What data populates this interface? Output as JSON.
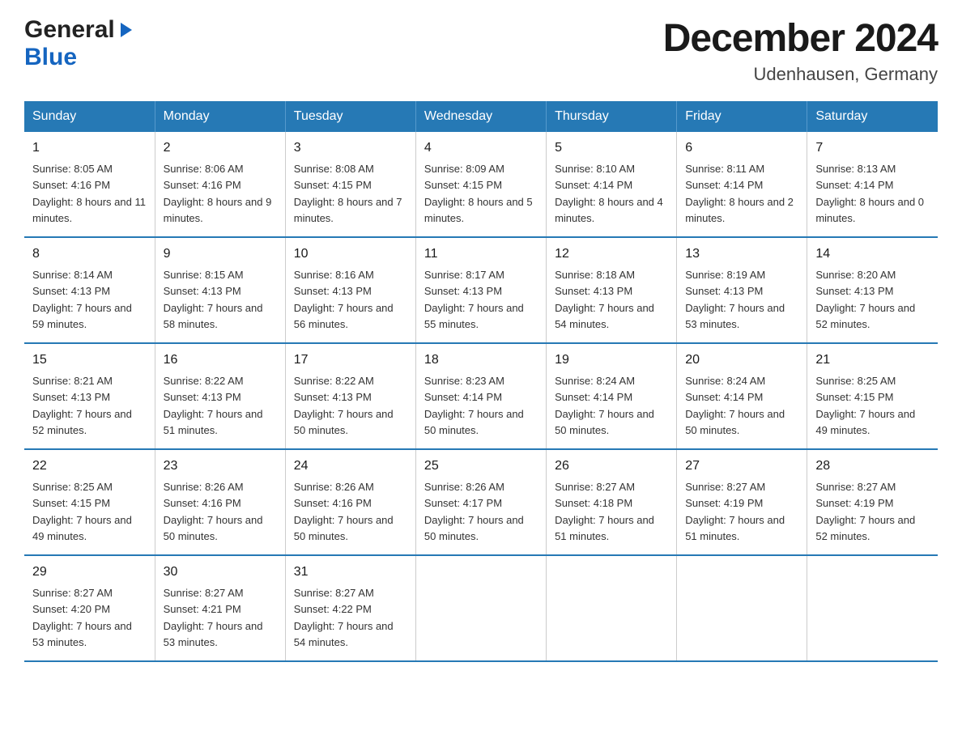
{
  "header": {
    "logo_general": "General",
    "logo_blue": "Blue",
    "month_title": "December 2024",
    "location": "Udenhausen, Germany"
  },
  "weekdays": [
    "Sunday",
    "Monday",
    "Tuesday",
    "Wednesday",
    "Thursday",
    "Friday",
    "Saturday"
  ],
  "weeks": [
    [
      {
        "day": "1",
        "sunrise": "8:05 AM",
        "sunset": "4:16 PM",
        "daylight": "8 hours and 11 minutes."
      },
      {
        "day": "2",
        "sunrise": "8:06 AM",
        "sunset": "4:16 PM",
        "daylight": "8 hours and 9 minutes."
      },
      {
        "day": "3",
        "sunrise": "8:08 AM",
        "sunset": "4:15 PM",
        "daylight": "8 hours and 7 minutes."
      },
      {
        "day": "4",
        "sunrise": "8:09 AM",
        "sunset": "4:15 PM",
        "daylight": "8 hours and 5 minutes."
      },
      {
        "day": "5",
        "sunrise": "8:10 AM",
        "sunset": "4:14 PM",
        "daylight": "8 hours and 4 minutes."
      },
      {
        "day": "6",
        "sunrise": "8:11 AM",
        "sunset": "4:14 PM",
        "daylight": "8 hours and 2 minutes."
      },
      {
        "day": "7",
        "sunrise": "8:13 AM",
        "sunset": "4:14 PM",
        "daylight": "8 hours and 0 minutes."
      }
    ],
    [
      {
        "day": "8",
        "sunrise": "8:14 AM",
        "sunset": "4:13 PM",
        "daylight": "7 hours and 59 minutes."
      },
      {
        "day": "9",
        "sunrise": "8:15 AM",
        "sunset": "4:13 PM",
        "daylight": "7 hours and 58 minutes."
      },
      {
        "day": "10",
        "sunrise": "8:16 AM",
        "sunset": "4:13 PM",
        "daylight": "7 hours and 56 minutes."
      },
      {
        "day": "11",
        "sunrise": "8:17 AM",
        "sunset": "4:13 PM",
        "daylight": "7 hours and 55 minutes."
      },
      {
        "day": "12",
        "sunrise": "8:18 AM",
        "sunset": "4:13 PM",
        "daylight": "7 hours and 54 minutes."
      },
      {
        "day": "13",
        "sunrise": "8:19 AM",
        "sunset": "4:13 PM",
        "daylight": "7 hours and 53 minutes."
      },
      {
        "day": "14",
        "sunrise": "8:20 AM",
        "sunset": "4:13 PM",
        "daylight": "7 hours and 52 minutes."
      }
    ],
    [
      {
        "day": "15",
        "sunrise": "8:21 AM",
        "sunset": "4:13 PM",
        "daylight": "7 hours and 52 minutes."
      },
      {
        "day": "16",
        "sunrise": "8:22 AM",
        "sunset": "4:13 PM",
        "daylight": "7 hours and 51 minutes."
      },
      {
        "day": "17",
        "sunrise": "8:22 AM",
        "sunset": "4:13 PM",
        "daylight": "7 hours and 50 minutes."
      },
      {
        "day": "18",
        "sunrise": "8:23 AM",
        "sunset": "4:14 PM",
        "daylight": "7 hours and 50 minutes."
      },
      {
        "day": "19",
        "sunrise": "8:24 AM",
        "sunset": "4:14 PM",
        "daylight": "7 hours and 50 minutes."
      },
      {
        "day": "20",
        "sunrise": "8:24 AM",
        "sunset": "4:14 PM",
        "daylight": "7 hours and 50 minutes."
      },
      {
        "day": "21",
        "sunrise": "8:25 AM",
        "sunset": "4:15 PM",
        "daylight": "7 hours and 49 minutes."
      }
    ],
    [
      {
        "day": "22",
        "sunrise": "8:25 AM",
        "sunset": "4:15 PM",
        "daylight": "7 hours and 49 minutes."
      },
      {
        "day": "23",
        "sunrise": "8:26 AM",
        "sunset": "4:16 PM",
        "daylight": "7 hours and 50 minutes."
      },
      {
        "day": "24",
        "sunrise": "8:26 AM",
        "sunset": "4:16 PM",
        "daylight": "7 hours and 50 minutes."
      },
      {
        "day": "25",
        "sunrise": "8:26 AM",
        "sunset": "4:17 PM",
        "daylight": "7 hours and 50 minutes."
      },
      {
        "day": "26",
        "sunrise": "8:27 AM",
        "sunset": "4:18 PM",
        "daylight": "7 hours and 51 minutes."
      },
      {
        "day": "27",
        "sunrise": "8:27 AM",
        "sunset": "4:19 PM",
        "daylight": "7 hours and 51 minutes."
      },
      {
        "day": "28",
        "sunrise": "8:27 AM",
        "sunset": "4:19 PM",
        "daylight": "7 hours and 52 minutes."
      }
    ],
    [
      {
        "day": "29",
        "sunrise": "8:27 AM",
        "sunset": "4:20 PM",
        "daylight": "7 hours and 53 minutes."
      },
      {
        "day": "30",
        "sunrise": "8:27 AM",
        "sunset": "4:21 PM",
        "daylight": "7 hours and 53 minutes."
      },
      {
        "day": "31",
        "sunrise": "8:27 AM",
        "sunset": "4:22 PM",
        "daylight": "7 hours and 54 minutes."
      },
      null,
      null,
      null,
      null
    ]
  ],
  "labels": {
    "sunrise_prefix": "Sunrise: ",
    "sunset_prefix": "Sunset: ",
    "daylight_prefix": "Daylight: "
  }
}
